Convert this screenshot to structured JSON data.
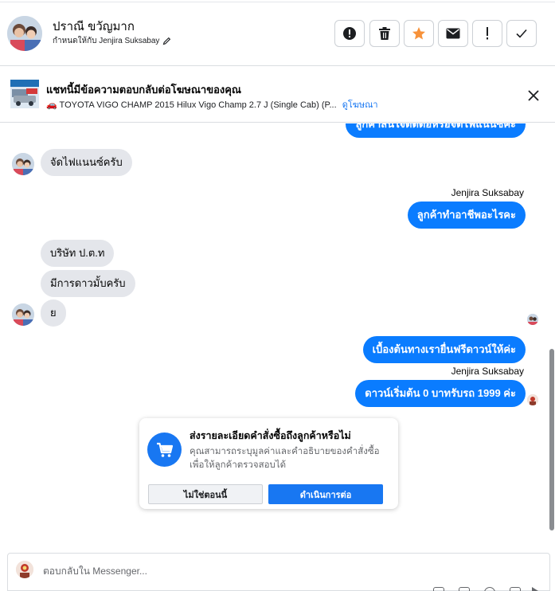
{
  "header": {
    "contact_name": "ปราณี ขวัญมาก",
    "assigned_label": "กำหนดให้กับ Jenjira Suksabay",
    "buttons": [
      {
        "name": "spam-button",
        "icon": "exclamation-circle-icon"
      },
      {
        "name": "delete-button",
        "icon": "trash-icon"
      },
      {
        "name": "star-button",
        "icon": "star-icon",
        "color": "#f7923a"
      },
      {
        "name": "mark-unread-button",
        "icon": "envelope-icon"
      },
      {
        "name": "follow-up-button",
        "icon": "exclamation-icon"
      },
      {
        "name": "done-button",
        "icon": "check-icon"
      }
    ]
  },
  "ad_banner": {
    "title": "แชทนี้มีข้อความตอบกลับต่อโฆษณาของคุณ",
    "subtitle": "🚗 TOYOTA VIGO CHAMP 2015 Hilux Vigo Champ 2.7 J (Single Cab) (P...",
    "link": "ดูโฆษณา"
  },
  "messages": {
    "m0": "ลูกค้าสนใจติดต่อหรือจัดไฟแนนซ์คะ",
    "m1": "จัดไฟแนนซ์ครับ",
    "sender1": "Jenjira Suksabay",
    "m2": "ลูกค้าทำอาชีพอะไรคะ",
    "m3": "บริษัท ป.ต.ท",
    "m4": "มีการดาวมั้บครับ",
    "m5": "ย",
    "m6": "เบื้องต้นทางเรายื่นฟรีดาวน์ให้ค่ะ",
    "sender2": "Jenjira Suksabay",
    "m7": "ดาวน์เริ่มต้น 0 บาทรับรถ 1999 ค่ะ"
  },
  "order_card": {
    "title": "ส่งรายละเอียดคำสั่งซื้อถึงลูกค้าหรือไม่",
    "description": "คุณสามารถระบุมูลค่าและคำอธิบายของคำสั่งซื้อเพื่อให้ลูกค้าตรวจสอบได้",
    "secondary_button": "ไม่ใช่ตอนนี้",
    "primary_button": "ดำเนินการต่อ",
    "accent": "#1877f2"
  },
  "composer": {
    "placeholder": "ตอบกลับใน Messenger..."
  },
  "colors": {
    "outgoing_bubble": "#0a7cff",
    "incoming_bubble": "#e4e6eb"
  }
}
